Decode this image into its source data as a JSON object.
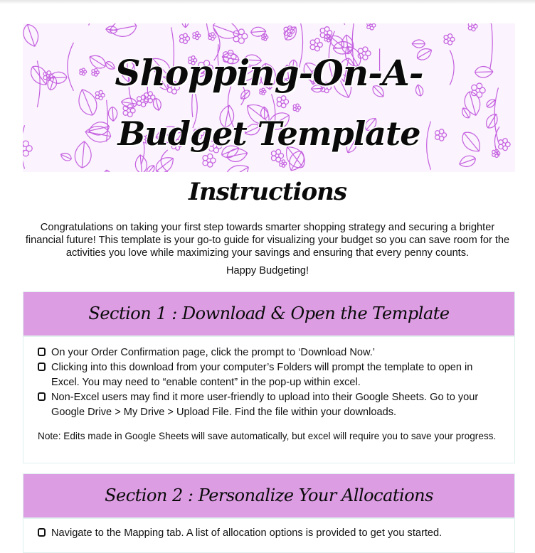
{
  "banner": {
    "title_line1": "Shopping-On-A-",
    "title_line2": "Budget Template",
    "pattern_color": "#c45fe0"
  },
  "instructions": {
    "title": "Instructions",
    "intro": "Congratulations on taking your first step towards smarter shopping strategy and securing a brighter financial future! This template is your go-to guide for visualizing your budget so you can save room for the activities you love while maximizing your savings and ensuring that every penny counts.",
    "sign_off": "Happy Budgeting!"
  },
  "colors": {
    "section_header_bg": "#dc9de3",
    "section_border": "#dff0ee"
  },
  "sections": [
    {
      "title": "Section 1 : Download & Open the Template",
      "items": [
        "On your Order Confirmation page, click the prompt to ‘Download Now.’",
        "Clicking into this download from your computer’s Folders will prompt the template to open in Excel. You may need to “enable content” in the pop-up within excel.",
        "Non-Excel users may find it more user-friendly to upload into their Google Sheets. Go to your Google Drive > My Drive > Upload File. Find the file within your downloads."
      ],
      "note": "Note: Edits made in Google Sheets will save automatically, but excel will require you to save your progress."
    },
    {
      "title": "Section 2 : Personalize Your Allocations",
      "items": [
        "Navigate to the Mapping tab. A list of allocation options is provided to get you started."
      ]
    }
  ]
}
